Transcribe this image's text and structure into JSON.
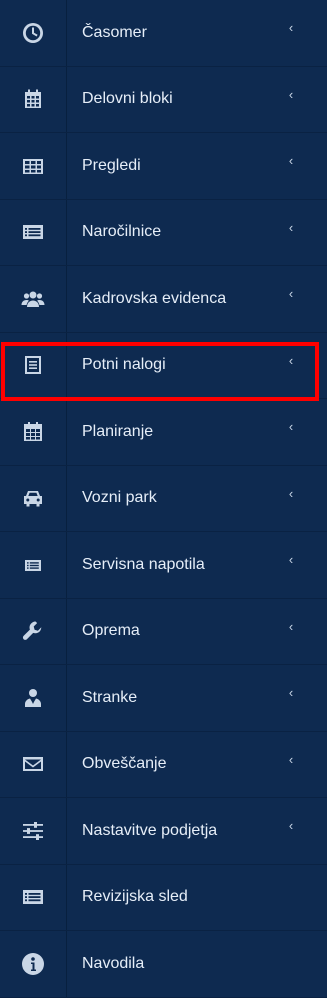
{
  "menu": {
    "items": [
      {
        "label": "Časomer",
        "icon": "clock-icon",
        "chevron": "‹"
      },
      {
        "label": "Delovni bloki",
        "icon": "calendar-icon",
        "chevron": "‹"
      },
      {
        "label": "Pregledi",
        "icon": "table-icon",
        "chevron": "‹"
      },
      {
        "label": "Naročilnice",
        "icon": "list-icon",
        "chevron": "‹"
      },
      {
        "label": "Kadrovska evidenca",
        "icon": "users-icon",
        "chevron": "‹"
      },
      {
        "label": "Potni nalogi",
        "icon": "document-icon",
        "chevron": "‹",
        "highlighted": true
      },
      {
        "label": "Planiranje",
        "icon": "calendar-icon",
        "chevron": "‹"
      },
      {
        "label": "Vozni park",
        "icon": "car-icon",
        "chevron": "‹"
      },
      {
        "label": "Servisna napotila",
        "icon": "list-icon",
        "chevron": "‹"
      },
      {
        "label": "Oprema",
        "icon": "wrench-icon",
        "chevron": "‹"
      },
      {
        "label": "Stranke",
        "icon": "user-tie-icon",
        "chevron": "‹"
      },
      {
        "label": "Obveščanje",
        "icon": "envelope-icon",
        "chevron": "‹"
      },
      {
        "label": "Nastavitve podjetja",
        "icon": "sliders-icon",
        "chevron": "‹"
      },
      {
        "label": "Revizijska sled",
        "icon": "list-icon",
        "chevron": ""
      },
      {
        "label": "Navodila",
        "icon": "info-icon",
        "chevron": ""
      }
    ]
  },
  "colors": {
    "background": "#0e2a50",
    "text": "#e6eef8",
    "icon": "#c9d6e6",
    "highlight_border": "#ff0000"
  }
}
